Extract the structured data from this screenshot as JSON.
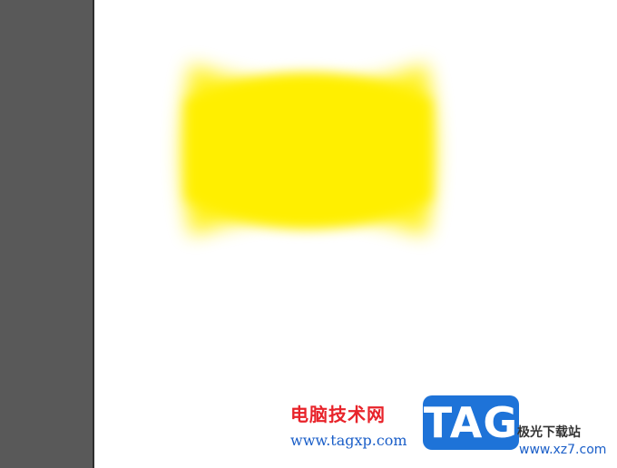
{
  "artwork": {
    "shape_color": "#ffef00"
  },
  "watermark": {
    "cn_text": "电脑技术网",
    "url": "www.tagxp.com",
    "badge": "TAG",
    "site_text": "极光下载站",
    "site_url": "www.xz7.com"
  },
  "colors": {
    "panel": "#595959",
    "canvas": "#ffffff",
    "watermark_red": "#e8232a",
    "watermark_blue": "#1e73d8"
  }
}
